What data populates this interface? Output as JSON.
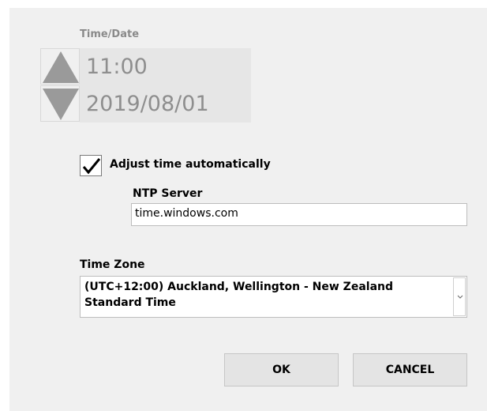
{
  "datetime": {
    "label": "Time/Date",
    "time": "11:00",
    "date": "2019/08/01",
    "up_icon": "triangle-up-icon",
    "down_icon": "triangle-down-icon"
  },
  "auto_adjust": {
    "checked": true,
    "label": "Adjust time automatically"
  },
  "ntp": {
    "label": "NTP Server",
    "value": "time.windows.com"
  },
  "timezone": {
    "label": "Time Zone",
    "selected": "(UTC+12:00) Auckland, Wellington  - New Zealand Standard Time",
    "arrow_icon": "chevron-down-icon"
  },
  "buttons": {
    "ok": "OK",
    "cancel": "CANCEL"
  },
  "colors": {
    "dialog_bg": "#f0f0f0",
    "disabled_text": "#8e8e8e",
    "spinner_arrow": "#9a9a9a",
    "button_bg": "#e4e4e4"
  }
}
